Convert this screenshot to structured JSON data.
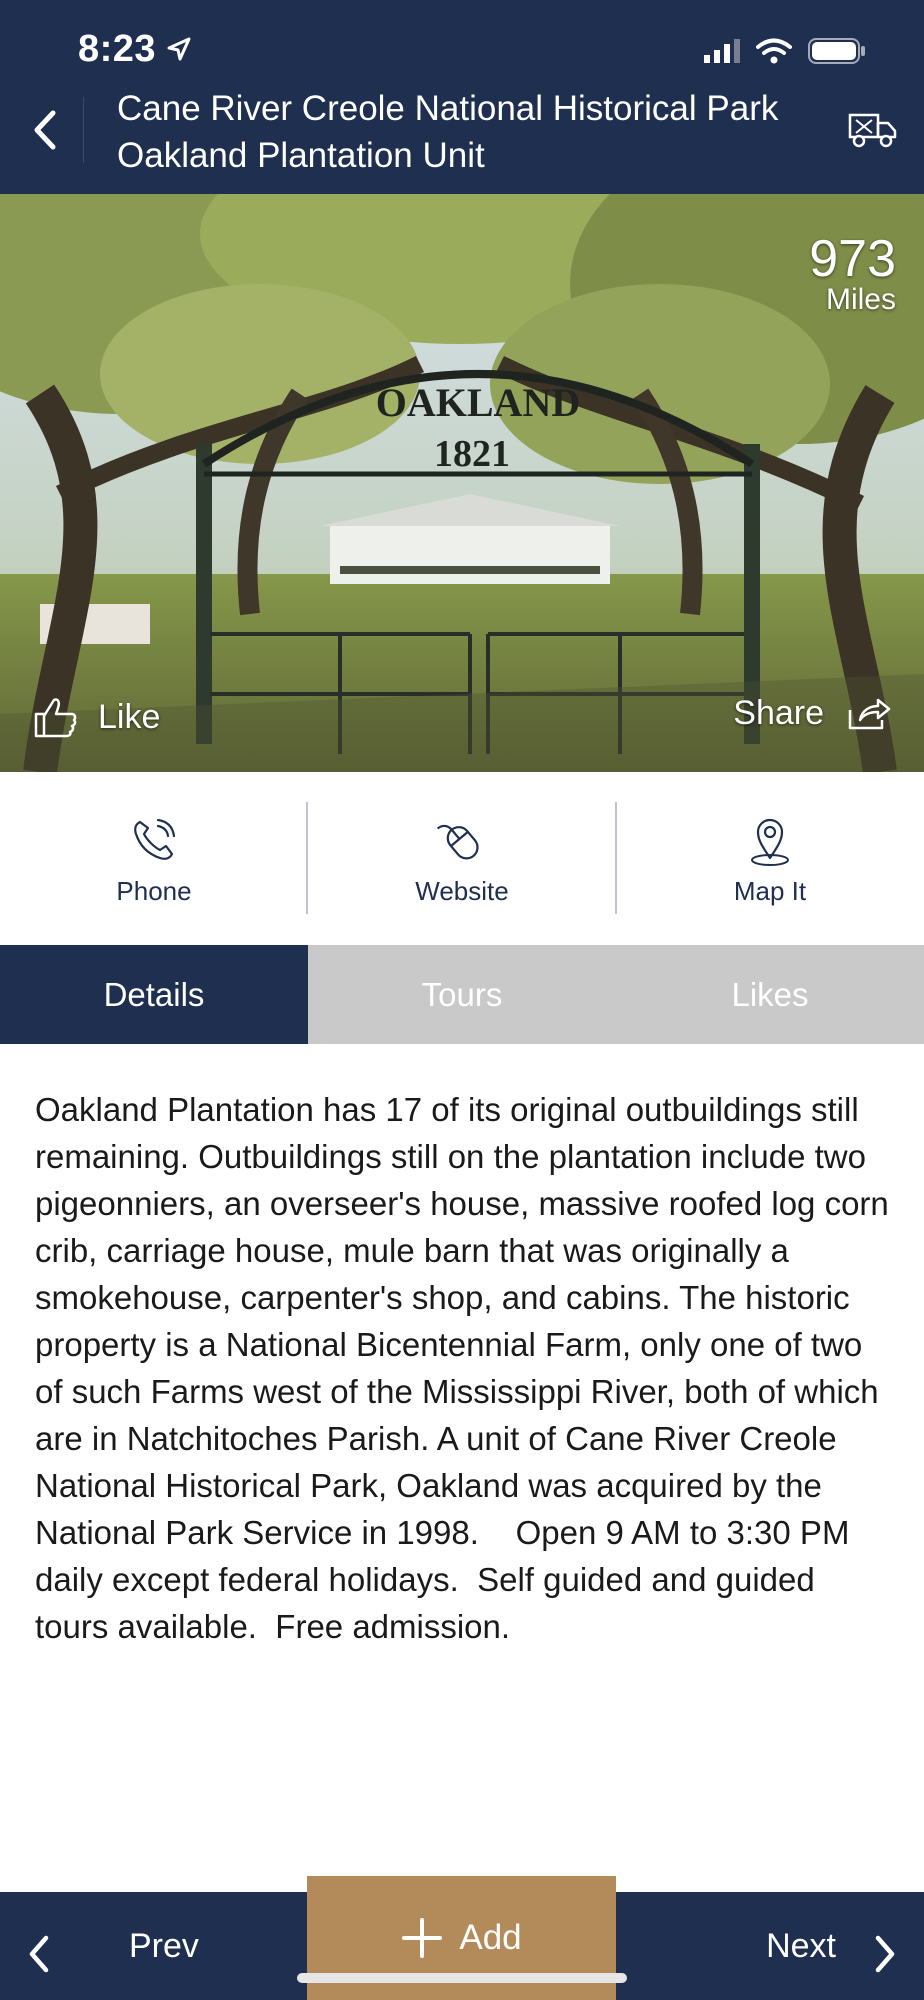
{
  "status_bar": {
    "time": "8:23"
  },
  "header": {
    "title_line1": "Cane River Creole National Historical Park",
    "title_line2": "Oakland Plantation Unit"
  },
  "hero": {
    "distance_value": "973",
    "distance_unit": "Miles",
    "like_label": "Like",
    "share_label": "Share",
    "sign_text": "OAKLAND",
    "sign_year": "1821"
  },
  "actions": [
    {
      "label": "Phone",
      "icon": "phone-icon"
    },
    {
      "label": "Website",
      "icon": "mouse-icon"
    },
    {
      "label": "Map It",
      "icon": "map-pin-icon"
    }
  ],
  "tabs": [
    {
      "label": "Details",
      "active": true
    },
    {
      "label": "Tours",
      "active": false
    },
    {
      "label": "Likes",
      "active": false
    }
  ],
  "details_text": "Oakland Plantation has 17 of its original outbuildings still remaining. Outbuildings still on the plantation include two pigeonniers, an overseer's house, massive roofed log corn crib, carriage house, mule barn that was originally a smokehouse, carpenter's shop, and cabins. The historic property is a National Bicentennial Farm, only one of two of such Farms west of the Mississippi River, both of which are in Natchitoches Parish. A unit of Cane River Creole National Historical Park, Oakland was acquired by the National Park Service in 1998.    Open 9 AM to 3:30 PM daily except federal holidays.  Self guided and guided tours available.  Free admission.",
  "bottom_nav": {
    "prev_label": "Prev",
    "add_label": "Add",
    "next_label": "Next"
  },
  "colors": {
    "navy": "#1f2f4f",
    "tab_inactive": "#c9c9c9",
    "add_button": "#b38b5a"
  }
}
